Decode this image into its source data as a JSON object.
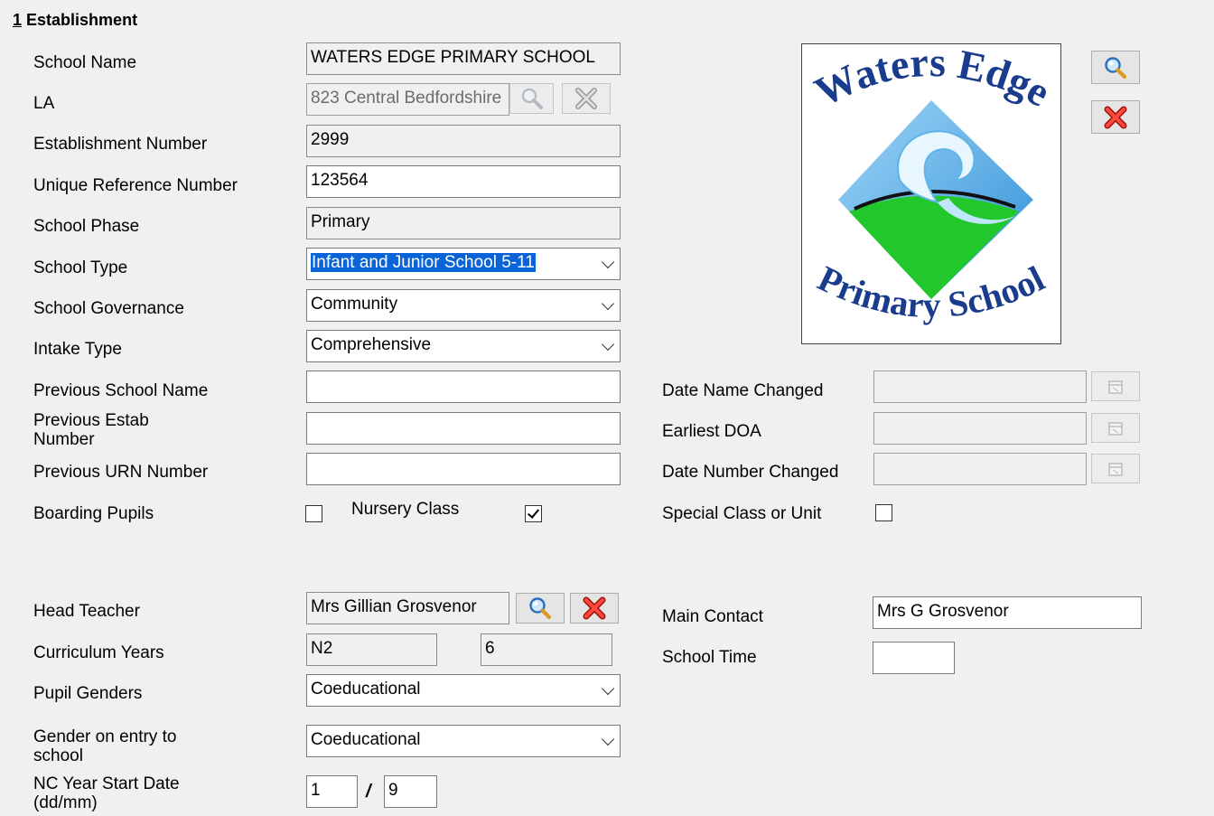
{
  "section": {
    "number": "1",
    "title": "Establishment"
  },
  "fields": {
    "school_name": {
      "label": "School Name",
      "value": "WATERS EDGE PRIMARY SCHOOL"
    },
    "la": {
      "label": "LA",
      "value": "823 Central Bedfordshire"
    },
    "establishment_number": {
      "label": "Establishment Number",
      "value": "2999"
    },
    "urn": {
      "label": "Unique Reference Number",
      "value": "123564"
    },
    "school_phase": {
      "label": "School Phase",
      "value": "Primary"
    },
    "school_type": {
      "label": "School Type",
      "value": "Infant and Junior School 5-11"
    },
    "school_governance": {
      "label": "School Governance",
      "value": "Community"
    },
    "intake_type": {
      "label": "Intake Type",
      "value": "Comprehensive"
    },
    "previous_school_name": {
      "label": "Previous School Name",
      "value": ""
    },
    "previous_estab_number": {
      "label": "Previous Estab Number",
      "value": ""
    },
    "previous_urn": {
      "label": "Previous URN Number",
      "value": ""
    },
    "boarding_pupils": {
      "label": "Boarding Pupils",
      "checked": false
    },
    "nursery_class": {
      "label": "Nursery Class",
      "checked": true
    },
    "date_name_changed": {
      "label": "Date Name Changed",
      "value": ""
    },
    "earliest_doa": {
      "label": "Earliest DOA",
      "value": ""
    },
    "date_number_changed": {
      "label": "Date Number Changed",
      "value": ""
    },
    "special_class": {
      "label": "Special Class or Unit",
      "checked": false
    },
    "head_teacher": {
      "label": "Head Teacher",
      "value": "Mrs Gillian Grosvenor"
    },
    "curriculum_years": {
      "label": "Curriculum Years",
      "from": "N2",
      "to": "6"
    },
    "pupil_genders": {
      "label": "Pupil Genders",
      "value": "Coeducational"
    },
    "gender_on_entry": {
      "label": "Gender on entry to school",
      "value": "Coeducational"
    },
    "nc_year_start": {
      "label": "NC Year Start Date (dd/mm)",
      "day": "1",
      "separator": "/",
      "month": "9"
    },
    "main_contact": {
      "label": "Main Contact",
      "value": "Mrs G Grosvenor"
    },
    "school_time": {
      "label": "School Time",
      "value": ""
    }
  },
  "logo": {
    "line1": "Waters Edge",
    "line2": "Primary School"
  },
  "icons": {
    "search": "magnifier-icon",
    "clear": "red-x-icon",
    "calendar": "calendar-icon"
  },
  "colors": {
    "logo_text": "#1a3c8c",
    "selection": "#0a64d8",
    "clear_red": "#e02020"
  }
}
